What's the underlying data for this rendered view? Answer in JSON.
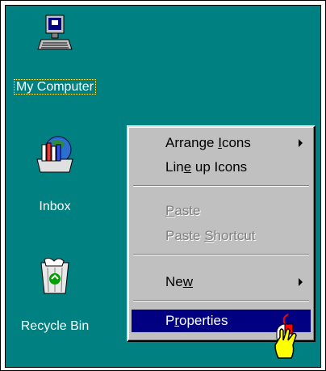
{
  "desktop": {
    "icons": [
      {
        "label": "My Computer",
        "icon": "my-computer-icon",
        "selected": true
      },
      {
        "label": "Inbox",
        "icon": "inbox-icon",
        "selected": false
      },
      {
        "label": "Recycle Bin",
        "icon": "recycle-bin-icon",
        "selected": false
      }
    ],
    "background_color": "#008080"
  },
  "context_menu": {
    "items": [
      {
        "label": "Arrange Icons",
        "pre": "Arrange ",
        "ul": "I",
        "post": "cons",
        "submenu": true,
        "disabled": false
      },
      {
        "label": "Line up Icons",
        "pre": "Lin",
        "ul": "e",
        "post": " up Icons",
        "submenu": false,
        "disabled": false
      },
      {
        "label": "Paste",
        "pre": "",
        "ul": "P",
        "post": "aste",
        "submenu": false,
        "disabled": true
      },
      {
        "label": "Paste Shortcut",
        "pre": "Paste ",
        "ul": "S",
        "post": "hortcut",
        "submenu": false,
        "disabled": true
      },
      {
        "label": "New",
        "pre": "Ne",
        "ul": "w",
        "post": "",
        "submenu": true,
        "disabled": false
      },
      {
        "label": "Properties",
        "pre": "P",
        "ul": "r",
        "post": "operties",
        "submenu": false,
        "disabled": false,
        "highlighted": true
      }
    ],
    "highlight_color": "#000080"
  },
  "cursor": {
    "icon": "pointing-hand-cursor-icon"
  }
}
